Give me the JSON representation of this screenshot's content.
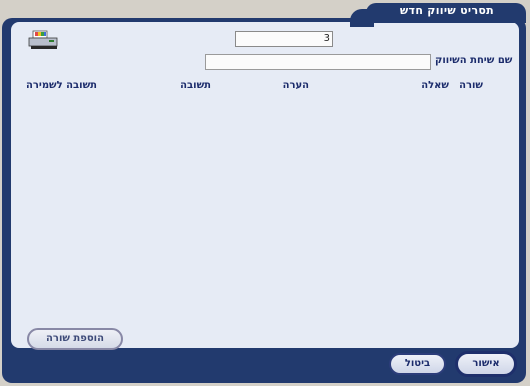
{
  "window": {
    "title": "תסריט שיווק חדש"
  },
  "form": {
    "number_value": "3",
    "marketing_call_name_label": "שם שיחת השיווק",
    "marketing_call_name_value": ""
  },
  "table": {
    "columns": {
      "row": "שורה",
      "question": "שאלה",
      "note": "הערה",
      "answer": "תשובה",
      "answer_to_save": "תשובה לשמירה"
    }
  },
  "buttons": {
    "add_row": "הוספת שורה",
    "cancel": "ביטול",
    "ok": "אישור"
  },
  "icons": {
    "print": "printer-icon"
  }
}
